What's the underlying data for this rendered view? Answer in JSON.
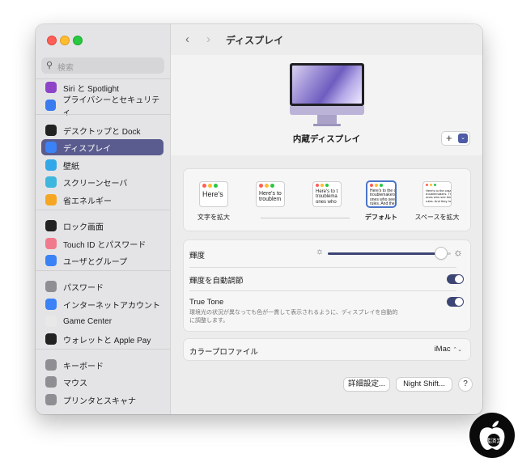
{
  "sidebar": {
    "search_placeholder": "検索",
    "groups": [
      [
        {
          "label": "Siri と Spotlight",
          "icon": "siri-icon",
          "color": "#8e44c8"
        },
        {
          "label": "プライバシーとセキュリティ",
          "icon": "hand-icon",
          "color": "#3b7bf0"
        }
      ],
      [
        {
          "label": "デスクトップと Dock",
          "icon": "dock-icon",
          "color": "#222222"
        },
        {
          "label": "ディスプレイ",
          "icon": "sun-icon",
          "color": "#3b82f6",
          "selected": true
        },
        {
          "label": "壁紙",
          "icon": "flower-icon",
          "color": "#32a8e8"
        },
        {
          "label": "スクリーンセーバ",
          "icon": "screensaver-icon",
          "color": "#3fb6dd"
        },
        {
          "label": "省エネルギー",
          "icon": "bulb-icon",
          "color": "#f5a623"
        }
      ],
      [
        {
          "label": "ロック画面",
          "icon": "lock-icon",
          "color": "#222222"
        },
        {
          "label": "Touch ID とパスワード",
          "icon": "fingerprint-icon",
          "color": "#f07a8c"
        },
        {
          "label": "ユーザとグループ",
          "icon": "users-icon",
          "color": "#3b82f6"
        }
      ],
      [
        {
          "label": "パスワード",
          "icon": "key-icon",
          "color": "#8e8e93"
        },
        {
          "label": "インターネットアカウント",
          "icon": "at-icon",
          "color": "#3b82f6"
        },
        {
          "label": "Game Center",
          "icon": "gamecenter-icon",
          "color": "#e8e8e8"
        },
        {
          "label": "ウォレットと Apple Pay",
          "icon": "wallet-icon",
          "color": "#222222"
        }
      ],
      [
        {
          "label": "キーボード",
          "icon": "keyboard-icon",
          "color": "#8e8e93"
        },
        {
          "label": "マウス",
          "icon": "mouse-icon",
          "color": "#8e8e93"
        },
        {
          "label": "プリンタとスキャナ",
          "icon": "printer-icon",
          "color": "#8e8e93"
        }
      ]
    ]
  },
  "toolbar": {
    "back": "‹",
    "forward": "›",
    "title": "ディスプレイ"
  },
  "display": {
    "name": "内蔵ディスプレイ",
    "add": "+",
    "chevron": "⌄"
  },
  "resolution": {
    "options": [
      {
        "label": "文字を拡大",
        "preview": "Here's",
        "selected": false
      },
      {
        "label": "",
        "preview": "Here's to troublem",
        "selected": false
      },
      {
        "label": "",
        "preview": "Here's to t troublema ones who",
        "selected": false
      },
      {
        "label": "デフォルト",
        "preview": "Here's to the cr troublemakers ones who see t rules. And the",
        "selected": true
      },
      {
        "label": "スペースを拡大",
        "preview": "Here's to the crazy troublemakers. The r ones who see things d rules. And they have",
        "selected": false
      }
    ]
  },
  "settings": {
    "brightness_label": "輝度",
    "brightness_level": 0.92,
    "auto_label": "輝度を自動調節",
    "auto_on": true,
    "truetone_label": "True Tone",
    "truetone_desc_1": "環境光の状況が異なっても色が一貫して表示されるように、ディスプレイを自動的",
    "truetone_desc_2": "に調整します。",
    "truetone_on": true,
    "profile_label": "カラープロファイル",
    "profile_value": "iMac",
    "profile_chevron": "⌃⌄"
  },
  "buttons": {
    "advanced": "詳細設定...",
    "night_shift": "Night Shift...",
    "help": "?"
  }
}
